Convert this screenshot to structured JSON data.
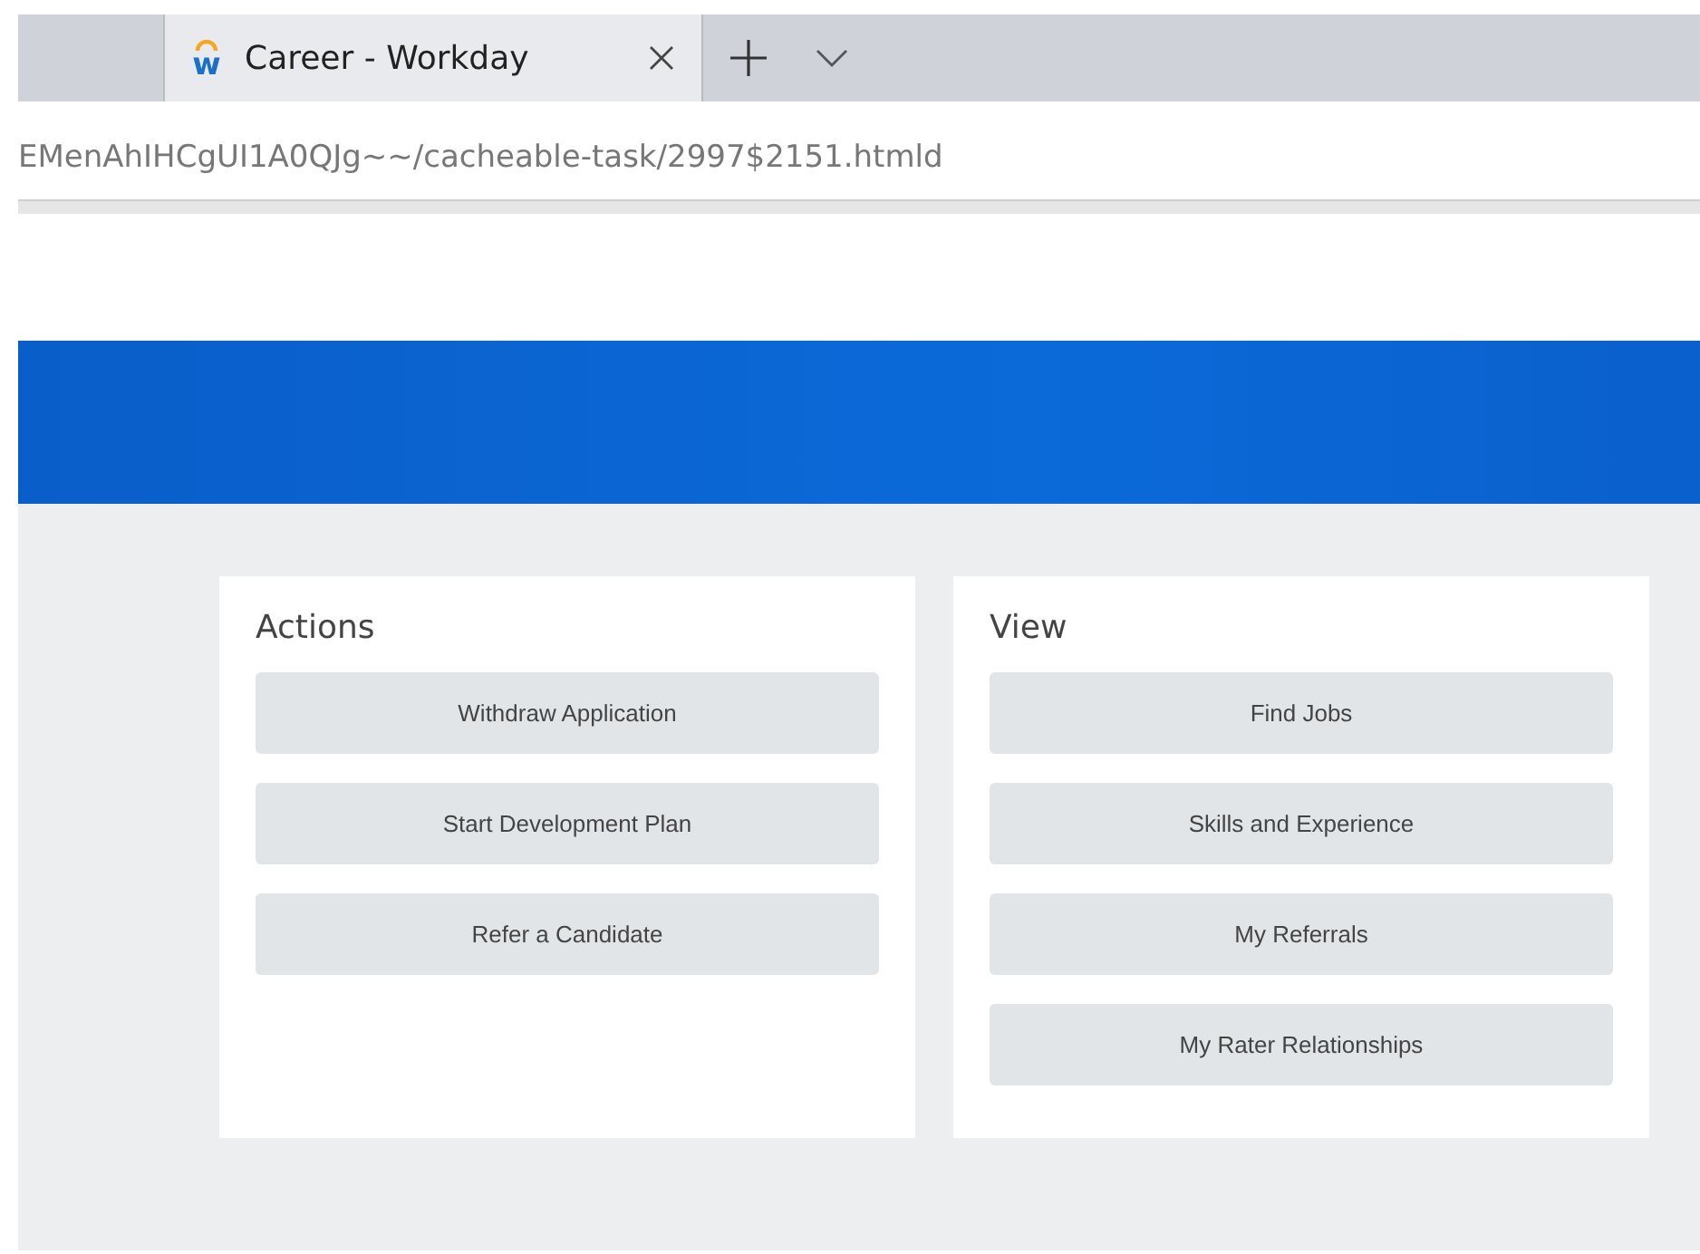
{
  "browser": {
    "tab": {
      "logo_letter": "w",
      "title": "Career - Workday",
      "selected": true
    },
    "address": "EMenAhIHCgUI1A0QJg~~/cacheable-task/2997$2151.htmld"
  },
  "panels": [
    {
      "title": "Actions",
      "buttons": [
        "Withdraw Application",
        "Start Development Plan",
        "Refer a Candidate"
      ]
    },
    {
      "title": "View",
      "buttons": [
        "Find Jobs",
        "Skills and Experience",
        "My Referrals",
        "My Rater Relationships"
      ]
    }
  ]
}
